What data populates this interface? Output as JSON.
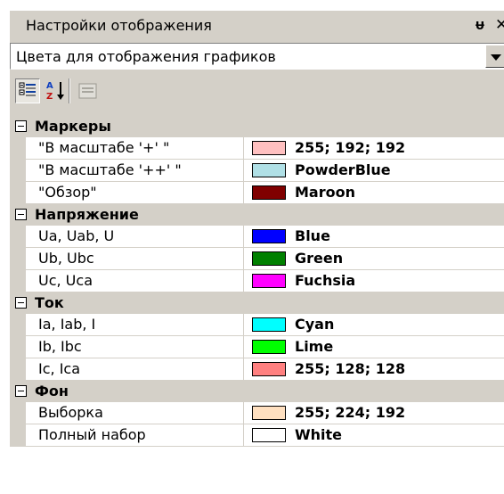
{
  "window": {
    "title": "Настройки отображения",
    "pin_glyph": "ᵾ",
    "close_glyph": "✕"
  },
  "selector": {
    "value": "Цвета для отображения графиков"
  },
  "toolbar": {
    "buttons": [
      {
        "name": "categorized-icon",
        "active": true
      },
      {
        "name": "alphabetical-icon",
        "active": false
      },
      {
        "name": "property-pages-icon",
        "active": false
      }
    ]
  },
  "grid": {
    "categories": [
      {
        "label": "Маркеры",
        "items": [
          {
            "name": "\"В масштабе '+' \"",
            "value": "255; 192; 192",
            "color": "#ffc0c0"
          },
          {
            "name": "\"В масштабе '++' \"",
            "value": "PowderBlue",
            "color": "#b0e0e6"
          },
          {
            "name": "\"Обзор\"",
            "value": "Maroon",
            "color": "#800000"
          }
        ]
      },
      {
        "label": "Напряжение",
        "items": [
          {
            "name": "Ua, Uab, U",
            "value": "Blue",
            "color": "#0000ff"
          },
          {
            "name": "Ub, Ubc",
            "value": "Green",
            "color": "#008000"
          },
          {
            "name": "Uc, Uca",
            "value": "Fuchsia",
            "color": "#ff00ff"
          }
        ]
      },
      {
        "label": "Ток",
        "items": [
          {
            "name": "Ia, Iab, I",
            "value": "Cyan",
            "color": "#00ffff"
          },
          {
            "name": "Ib, Ibc",
            "value": "Lime",
            "color": "#00ff00"
          },
          {
            "name": "Ic, Ica",
            "value": "255; 128; 128",
            "color": "#ff8080"
          }
        ]
      },
      {
        "label": "Фон",
        "items": [
          {
            "name": "Выборка",
            "value": "255; 224; 192",
            "color": "#ffe0c0"
          },
          {
            "name": "Полный набор",
            "value": "White",
            "color": "#ffffff"
          }
        ]
      }
    ]
  }
}
